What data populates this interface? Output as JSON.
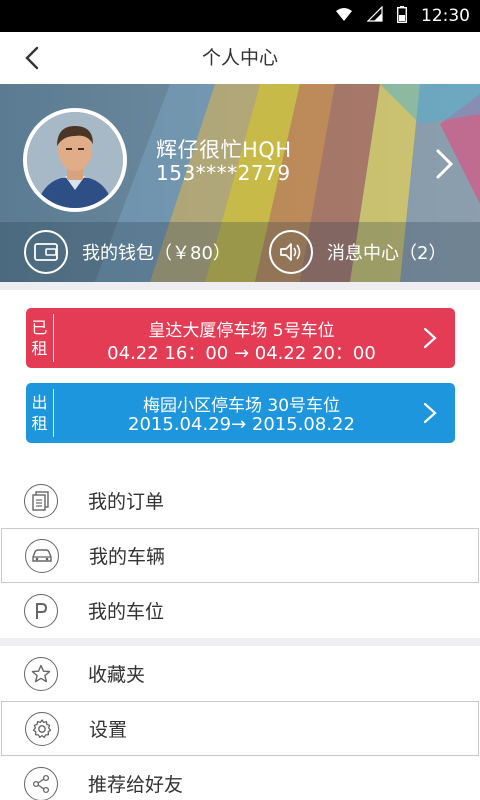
{
  "status_bar": {
    "time": "12:30",
    "icons": [
      "wifi-icon",
      "signal-icon",
      "battery-icon"
    ]
  },
  "nav": {
    "title": "个人中心",
    "back_icon": "chevron-left-icon"
  },
  "profile": {
    "name": "辉仔很忙HQH",
    "phone": "153****2779",
    "arrow_icon": "chevron-right-icon"
  },
  "wallet": {
    "label": "我的钱包（￥80）",
    "icon": "wallet-icon"
  },
  "messages": {
    "label": "消息中心（2）",
    "icon": "speaker-icon"
  },
  "cards": [
    {
      "tag": [
        "已",
        "租"
      ],
      "line1": "皇达大厦停车场  5号车位",
      "line2": "04.22 16：00 → 04.22 20：00",
      "color": "#e43c55"
    },
    {
      "tag": [
        "出",
        "租"
      ],
      "line1": "梅园小区停车场  30号车位",
      "line2": "2015.04.29→ 2015.08.22",
      "color": "#1d96de"
    }
  ],
  "menu": {
    "orders": {
      "label": "我的订单",
      "icon": "document-icon"
    },
    "vehicles": {
      "label": "我的车辆",
      "icon": "car-icon"
    },
    "spaces": {
      "label": "我的车位",
      "icon": "parking-icon"
    },
    "favorites": {
      "label": "收藏夹",
      "icon": "star-icon"
    },
    "settings": {
      "label": "设置",
      "icon": "gear-icon"
    },
    "share": {
      "label": "推荐给好友",
      "icon": "share-icon"
    }
  }
}
